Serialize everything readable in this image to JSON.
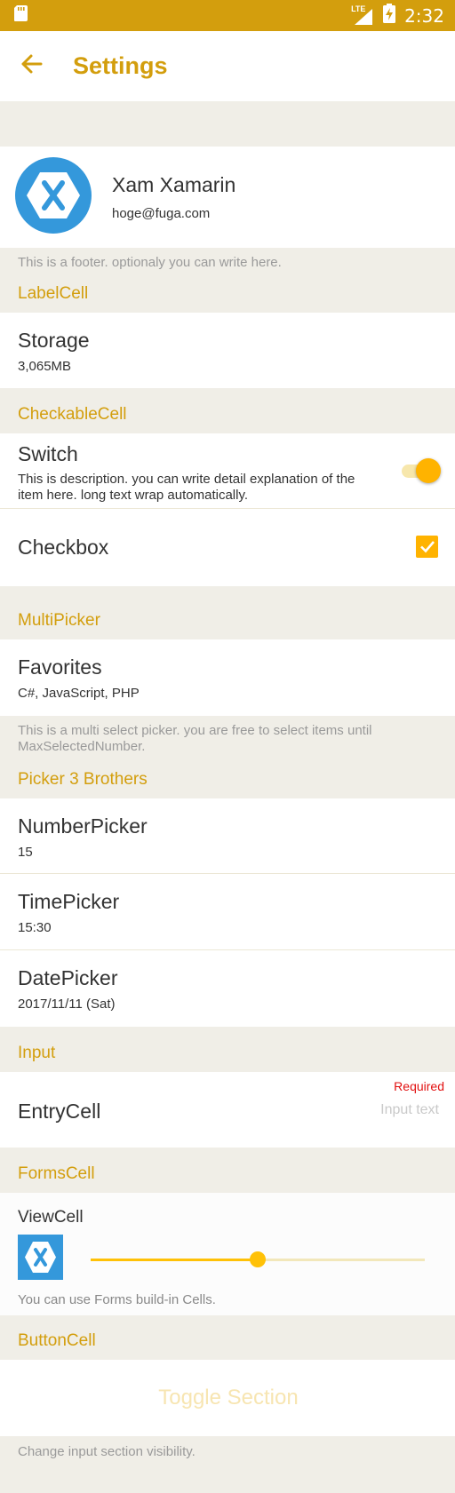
{
  "status": {
    "time": "2:32",
    "network": "LTE"
  },
  "nav": {
    "title": "Settings"
  },
  "profile": {
    "name": "Xam Xamarin",
    "email": "hoge@fuga.com",
    "footer": "This is a footer. optionaly you can write here."
  },
  "sections": {
    "label": {
      "header": "LabelCell",
      "title": "Storage",
      "value": "3,065MB"
    },
    "checkable": {
      "header": "CheckableCell",
      "switch_title": "Switch",
      "switch_desc": "This is description. you can write detail explanation of the item here. long text wrap automatically.",
      "switch_on": true,
      "checkbox_title": "Checkbox",
      "checkbox_checked": true
    },
    "multipicker": {
      "header": "MultiPicker",
      "title": "Favorites",
      "value": "C#, JavaScript, PHP",
      "footer": "This is a multi select picker. you are free to select items until MaxSelectedNumber."
    },
    "pickers": {
      "header": "Picker 3 Brothers",
      "number_title": "NumberPicker",
      "number_value": "15",
      "time_title": "TimePicker",
      "time_value": "15:30",
      "date_title": "DatePicker",
      "date_value": "2017/11/11 (Sat)"
    },
    "input": {
      "header": "Input",
      "title": "EntryCell",
      "required": "Required",
      "placeholder": "Input text"
    },
    "forms": {
      "header": "FormsCell",
      "title": "ViewCell",
      "slider_value": 0.5,
      "footer": "You can use Forms build-in Cells."
    },
    "button": {
      "header": "ButtonCell",
      "label": "Toggle Section",
      "footer": "Change input section visibility."
    }
  },
  "colors": {
    "accent": "#D39E0D",
    "toggle": "#FFB300",
    "background": "#F0EEE7",
    "xamarin_blue": "#3498DB",
    "required": "#E21010"
  }
}
